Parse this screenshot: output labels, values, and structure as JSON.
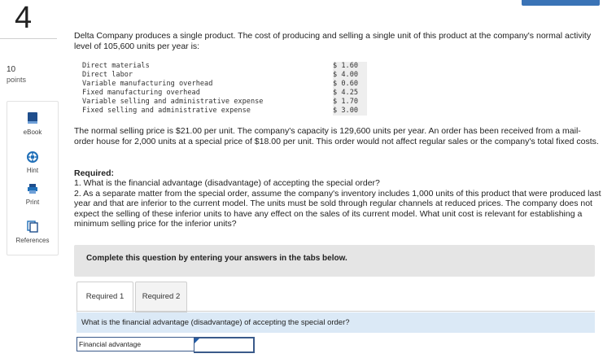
{
  "question": {
    "number": "4",
    "points_value": "10",
    "points_label": "points"
  },
  "tools": {
    "ebook": "eBook",
    "hint": "Hint",
    "print": "Print",
    "references": "References"
  },
  "problem": {
    "intro": "Delta Company produces a single product. The cost of producing and selling a single unit of this product at the company's normal activity level of 105,600 units per year is:",
    "costs": [
      {
        "label": "Direct materials",
        "amount": "$ 1.60"
      },
      {
        "label": "Direct labor",
        "amount": "$ 4.00"
      },
      {
        "label": "Variable manufacturing overhead",
        "amount": "$ 0.60"
      },
      {
        "label": "Fixed manufacturing overhead",
        "amount": "$ 4.25"
      },
      {
        "label": "Variable selling and administrative expense",
        "amount": "$ 1.70"
      },
      {
        "label": "Fixed selling and administrative expense",
        "amount": "$ 3.00"
      }
    ],
    "paragraph2": "The normal selling price is $21.00 per unit. The company's capacity is 129,600 units per year. An order has been received from a mail-order house for 2,000 units at a special price of $18.00 per unit. This order would not affect regular sales or the company's total fixed costs.",
    "required_title": "Required:",
    "required_1": "1. What is the financial advantage (disadvantage) of accepting the special order?",
    "required_2": "2. As a separate matter from the special order, assume the company's inventory includes 1,000 units of this product that were produced last year and that are inferior to the current model. The units must be sold through regular channels at reduced prices. The company does not expect the selling of these inferior units to have any effect on the sales of its current model. What unit cost is relevant for establishing a minimum selling price for the inferior units?"
  },
  "instructions": "Complete this question by entering your answers in the tabs below.",
  "tabs": [
    {
      "label": "Required 1"
    },
    {
      "label": "Required 2"
    }
  ],
  "tab_question": "What is the financial advantage (disadvantage) of accepting the special order?",
  "answer": {
    "label": "Financial advantage",
    "value": ""
  },
  "colors": {
    "accent": "#3a73b6",
    "question_bar": "#dbe9f6",
    "instruction_box": "#e5e5e5"
  }
}
